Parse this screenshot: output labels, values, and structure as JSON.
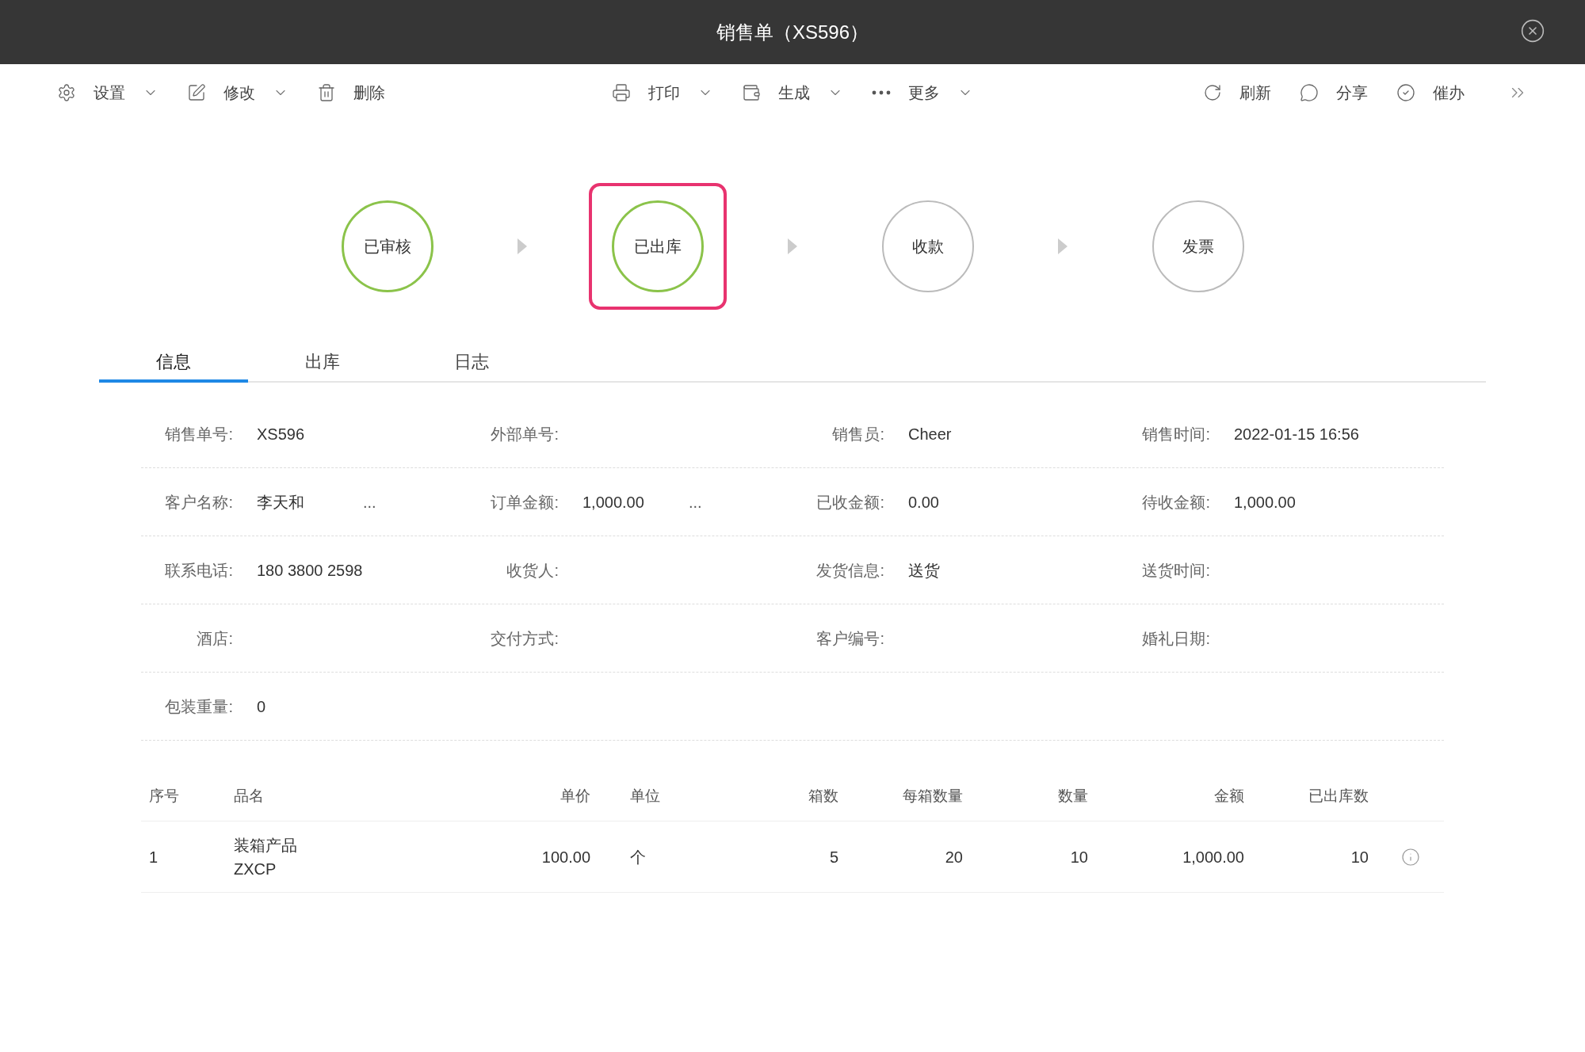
{
  "window": {
    "title": "销售单（XS596）"
  },
  "toolbar": {
    "left": [
      {
        "kind": "settings",
        "label": "设置",
        "dropdown": true
      },
      {
        "kind": "edit",
        "label": "修改",
        "dropdown": true
      },
      {
        "kind": "delete",
        "label": "删除",
        "dropdown": false
      }
    ],
    "center": [
      {
        "kind": "print",
        "label": "打印",
        "dropdown": true
      },
      {
        "kind": "generate",
        "label": "生成",
        "dropdown": true
      },
      {
        "kind": "more",
        "label": "更多",
        "dropdown": true
      }
    ],
    "right": [
      {
        "kind": "refresh",
        "label": "刷新",
        "dropdown": false
      },
      {
        "kind": "share",
        "label": "分享",
        "dropdown": false
      },
      {
        "kind": "urge",
        "label": "催办",
        "dropdown": false
      }
    ]
  },
  "steps": [
    {
      "label": "已审核",
      "done": true,
      "selected": false
    },
    {
      "label": "已出库",
      "done": true,
      "selected": true
    },
    {
      "label": "收款",
      "done": false,
      "selected": false
    },
    {
      "label": "发票",
      "done": false,
      "selected": false
    }
  ],
  "tabs": [
    {
      "label": "信息",
      "selected": true
    },
    {
      "label": "出库",
      "selected": false
    },
    {
      "label": "日志",
      "selected": false
    }
  ],
  "form": [
    [
      {
        "label": "销售单号:",
        "value": "XS596"
      },
      {
        "label": "外部单号:"
      },
      {
        "label": "销售员:",
        "value": "Cheer"
      },
      {
        "label": "销售时间:",
        "value": "2022-01-15 16:56"
      }
    ],
    [
      {
        "label": "客户名称:",
        "value": "李天和",
        "more": "..."
      },
      {
        "label": "订单金额:",
        "value": "1,000.00",
        "more": "..."
      },
      {
        "label": "已收金额:",
        "value": "0.00"
      },
      {
        "label": "待收金额:",
        "value": "1,000.00"
      }
    ],
    [
      {
        "label": "联系电话:",
        "value": "180 3800 2598"
      },
      {
        "label": "收货人:"
      },
      {
        "label": "发货信息:",
        "value": "送货"
      },
      {
        "label": "送货时间:"
      }
    ],
    [
      {
        "label": "酒店:"
      },
      {
        "label": "交付方式:"
      },
      {
        "label": "客户编号:"
      },
      {
        "label": "婚礼日期:"
      }
    ],
    [
      {
        "label": "包装重量:",
        "value": "0"
      }
    ]
  ],
  "table": {
    "columns": [
      "序号",
      "品名",
      "单价",
      "单位",
      "箱数",
      "每箱数量",
      "数量",
      "金额",
      "已出库数"
    ],
    "rows": [
      {
        "cells": [
          "1",
          [
            "装箱产品",
            "ZXCP"
          ],
          "100.00",
          "个",
          "5",
          "20",
          "10",
          "1,000.00",
          "10"
        ]
      }
    ]
  }
}
